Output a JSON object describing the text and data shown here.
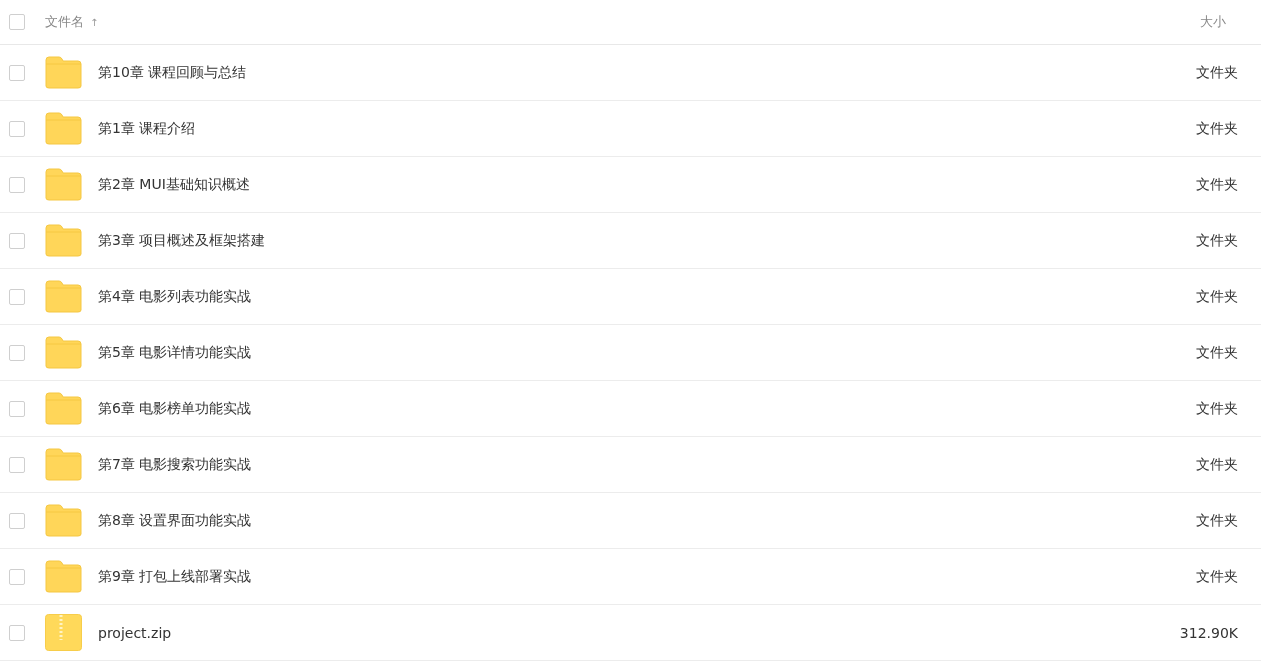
{
  "header": {
    "checked": false,
    "name_label": "文件名",
    "sort_arrow": "↑",
    "size_label": "大小"
  },
  "rows": [
    {
      "kind": "folder",
      "name": "第10章 课程回顾与总结",
      "size": "文件夹",
      "checked": false
    },
    {
      "kind": "folder",
      "name": "第1章 课程介绍",
      "size": "文件夹",
      "checked": false
    },
    {
      "kind": "folder",
      "name": "第2章 MUI基础知识概述",
      "size": "文件夹",
      "checked": false
    },
    {
      "kind": "folder",
      "name": "第3章 项目概述及框架搭建",
      "size": "文件夹",
      "checked": false
    },
    {
      "kind": "folder",
      "name": "第4章 电影列表功能实战",
      "size": "文件夹",
      "checked": false
    },
    {
      "kind": "folder",
      "name": "第5章 电影详情功能实战",
      "size": "文件夹",
      "checked": false
    },
    {
      "kind": "folder",
      "name": "第6章 电影榜单功能实战",
      "size": "文件夹",
      "checked": false
    },
    {
      "kind": "folder",
      "name": "第7章 电影搜索功能实战",
      "size": "文件夹",
      "checked": false
    },
    {
      "kind": "folder",
      "name": "第8章 设置界面功能实战",
      "size": "文件夹",
      "checked": false
    },
    {
      "kind": "folder",
      "name": "第9章 打包上线部署实战",
      "size": "文件夹",
      "checked": false
    },
    {
      "kind": "zip",
      "name": "project.zip",
      "size": "312.90K",
      "checked": false
    }
  ]
}
